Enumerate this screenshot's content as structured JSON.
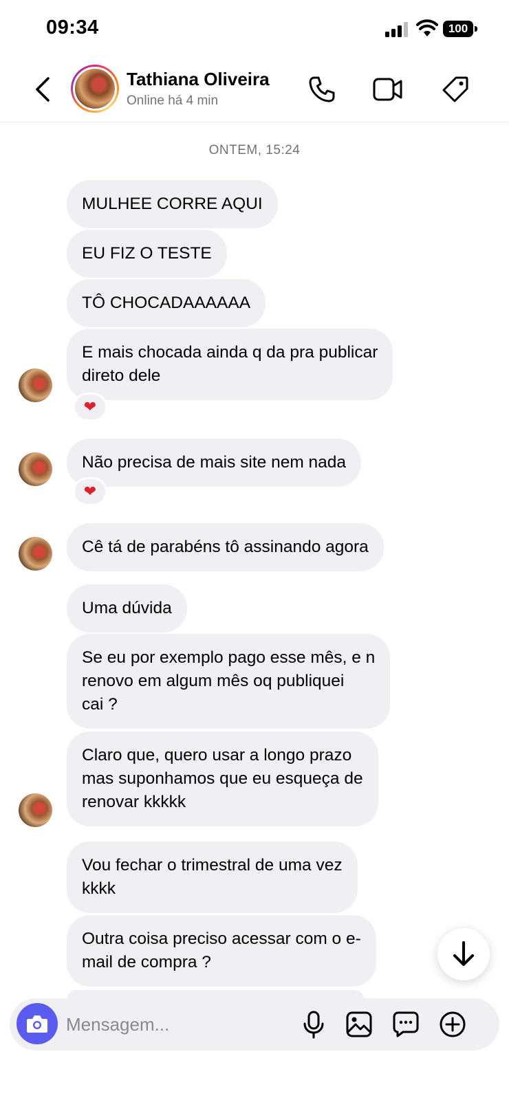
{
  "status_bar": {
    "time": "09:34",
    "battery": "100"
  },
  "header": {
    "contact_name": "Tathiana Oliveira",
    "contact_status": "Online há 4 min",
    "icons": [
      "back-icon",
      "phone-icon",
      "video-icon",
      "tag-icon"
    ]
  },
  "chat": {
    "timestamp": "ONTEM, 15:24",
    "messages": [
      {
        "text": "MULHEE CORRE AQUI"
      },
      {
        "text": "EU FIZ O TESTE"
      },
      {
        "text": "TÔ CHOCADAAAAAA"
      },
      {
        "text": "E mais chocada ainda q da pra publicar\ndireto dele",
        "reaction": "❤"
      },
      {
        "text": "Não precisa de mais site nem nada",
        "reaction": "❤"
      },
      {
        "text": "Cê tá de parabéns tô assinando agora"
      },
      {
        "text": "Uma dúvida"
      },
      {
        "text": "Se eu por exemplo pago esse mês, e n\nrenovo em algum mês oq publiquei\ncai ?"
      },
      {
        "text": "Claro que, quero usar a longo prazo\nmas suponhamos que eu esqueça de\nrenovar kkkkk"
      },
      {
        "text": "Vou fechar o trimestral de uma vez\nkkkk"
      },
      {
        "text": "Outra coisa preciso acessar com o e-\nmail de compra ?"
      }
    ]
  },
  "composer": {
    "placeholder": "Mensagem...",
    "icons": [
      "camera-icon",
      "microphone-icon",
      "gallery-icon",
      "sticker-icon",
      "plus-icon"
    ]
  },
  "colors": {
    "bubble": "#efeff4",
    "camera_button": "#5a5cf0",
    "reaction_heart": "#e0202a"
  }
}
